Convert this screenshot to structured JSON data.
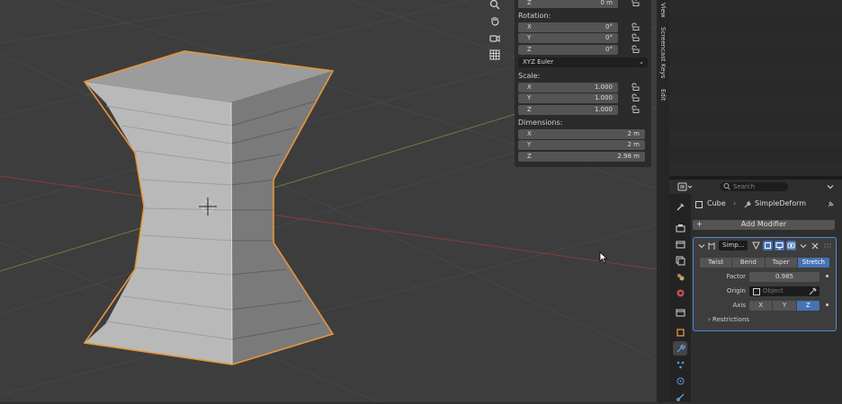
{
  "viewport": {
    "nav_icons": [
      "zoom-icon",
      "pan-hand-icon",
      "camera-view-icon",
      "grid-view-icon"
    ]
  },
  "transform_panel": {
    "location_z": {
      "axis": "Z",
      "value": "0 m"
    },
    "rotation_label": "Rotation:",
    "rotation": [
      {
        "axis": "X",
        "value": "0°"
      },
      {
        "axis": "Y",
        "value": "0°"
      },
      {
        "axis": "Z",
        "value": "0°"
      }
    ],
    "rotation_mode": "XYZ Euler",
    "scale_label": "Scale:",
    "scale": [
      {
        "axis": "X",
        "value": "1.000"
      },
      {
        "axis": "Y",
        "value": "1.000"
      },
      {
        "axis": "Z",
        "value": "1.000"
      }
    ],
    "dimensions_label": "Dimensions:",
    "dimensions": [
      {
        "axis": "X",
        "value": "2 m"
      },
      {
        "axis": "Y",
        "value": "2 m"
      },
      {
        "axis": "Z",
        "value": "2.98 m"
      }
    ]
  },
  "side_tabs": [
    "View",
    "Screencast Keys",
    "Edit"
  ],
  "properties": {
    "search_placeholder": "Search",
    "breadcrumb_object": "Cube",
    "breadcrumb_modifier": "SimpleDeform",
    "add_modifier_label": "Add Modifier",
    "modifier_name": "Simp...",
    "deform_modes": [
      "Twist",
      "Bend",
      "Taper",
      "Stretch"
    ],
    "active_mode": "Stretch",
    "factor_label": "Factor",
    "factor_value": "0.985",
    "origin_label": "Origin",
    "origin_placeholder": "Object",
    "axis_label": "Axis",
    "axes": [
      "X",
      "Y",
      "Z"
    ],
    "active_axis": "Z",
    "restrictions_label": "Restrictions"
  },
  "colors": {
    "accent_blue": "#4772b3",
    "selection_orange": "#e8953a",
    "x_axis_red": "#8a3b3b",
    "y_axis_green": "#6b7d3a"
  }
}
